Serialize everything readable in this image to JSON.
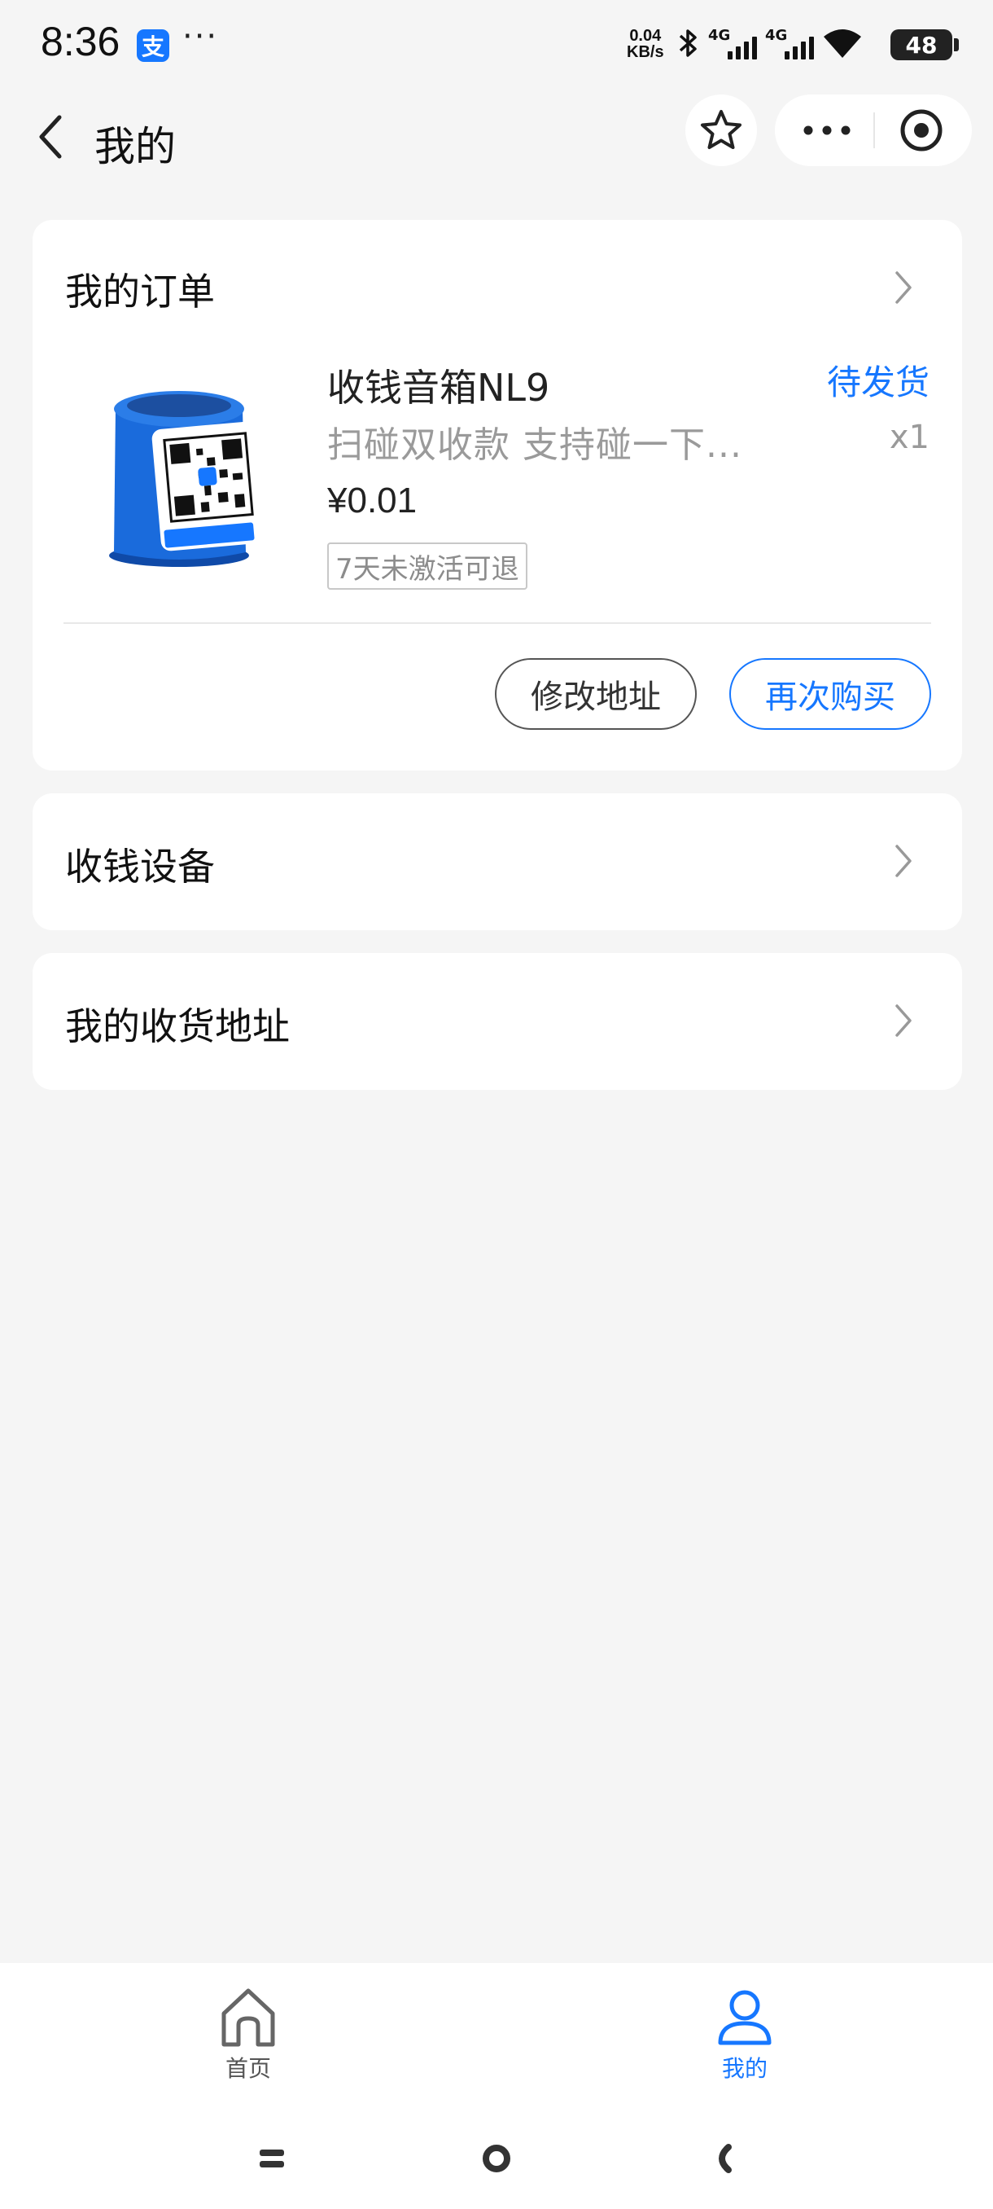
{
  "status_bar": {
    "time": "8:36",
    "app_badge": "支",
    "more": "···",
    "net_speed_value": "0.04",
    "net_speed_unit": "KB/s",
    "sim1": "4G",
    "sim2": "4G",
    "battery": "48"
  },
  "header": {
    "title": "我的"
  },
  "order_card": {
    "title": "我的订单",
    "product": {
      "name": "收钱音箱NL9",
      "status": "待发货",
      "description": "扫碰双收款  支持碰一下...",
      "quantity": "x1",
      "price": "¥0.01",
      "return_policy": "7天未激活可退",
      "image_label": "支付宝"
    },
    "buttons": {
      "modify_address": "修改地址",
      "buy_again": "再次购买"
    }
  },
  "menu": {
    "devices": "收钱设备",
    "addresses": "我的收货地址"
  },
  "tabbar": {
    "home": "首页",
    "mine": "我的"
  },
  "colors": {
    "accent": "#1677ff",
    "background": "#f5f5f5"
  }
}
